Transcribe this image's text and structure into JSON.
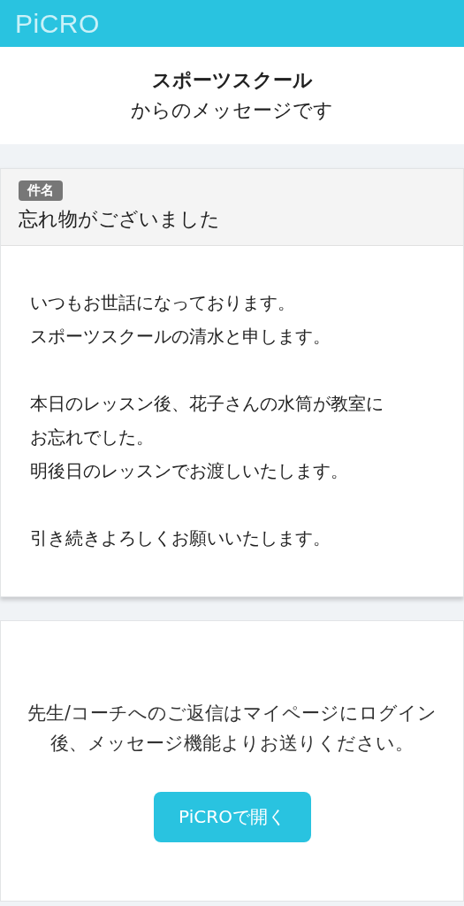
{
  "header": {
    "logo": "PiCRO"
  },
  "sender": {
    "name": "スポーツスクール",
    "suffix": "からのメッセージです"
  },
  "message": {
    "subject_label": "件名",
    "subject": "忘れ物がございました",
    "paragraphs": [
      [
        "いつもお世話になっております。",
        "スポーツスクールの清水と申します。"
      ],
      [
        "本日のレッスン後、花子さんの水筒が教室に",
        "お忘れでした。",
        "明後日のレッスンでお渡しいたします。"
      ],
      [
        "引き続きよろしくお願いいたします。"
      ]
    ]
  },
  "reply": {
    "notice": "先生/コーチへのご返信はマイページにログイン後、メッセージ機能よりお送りください。",
    "button": "PiCROで開く"
  }
}
